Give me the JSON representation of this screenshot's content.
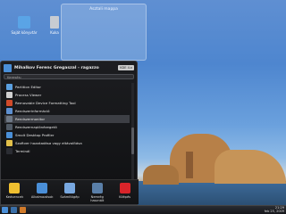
{
  "desktop": {
    "icons": [
      {
        "label": "Saját könyvtár",
        "icon": "home-folder-icon"
      },
      {
        "label": "Kuka",
        "icon": "trash-icon"
      }
    ],
    "folder_view_title": "Asztali mappa"
  },
  "launcher": {
    "user": "Mihalkov Ferenc Gregaszal - ragazzo",
    "kind_label": "KDE 4.x",
    "search_placeholder": "Keresés:",
    "apps": [
      {
        "label": "Partition Editor",
        "color": "#5aa0e0"
      },
      {
        "label": "Process Viewer",
        "color": "#d0d0d0"
      },
      {
        "label": "Removable Device Formatting Tool",
        "color": "#d04a2a"
      },
      {
        "label": "Rendszerinformáció",
        "color": "#5d8fd0"
      },
      {
        "label": "Rendszermonitor",
        "color": "#6e7886"
      },
      {
        "label": "Rendszernaplónézegetõ",
        "color": "#505a66"
      },
      {
        "label": "Smolt Desktop Profiler",
        "color": "#4a8fd8"
      },
      {
        "label": "Szoftver hozzáadása vagy eltávolítása",
        "color": "#e2c04a"
      },
      {
        "label": "Terminál",
        "color": "#2b2d33"
      }
    ],
    "tabs": [
      {
        "label": "Kedvencek",
        "color": "#f0c030"
      },
      {
        "label": "Alkalmazások",
        "color": "#4a8fd8"
      },
      {
        "label": "Számítógép",
        "color": "#78a8e0"
      },
      {
        "label": "Nemrég használt",
        "color": "#5a7fa8"
      },
      {
        "label": "Kilépés",
        "color": "#d8242a"
      }
    ]
  },
  "taskbar": {
    "time": "21:29",
    "date": "feb 25, 2009"
  }
}
